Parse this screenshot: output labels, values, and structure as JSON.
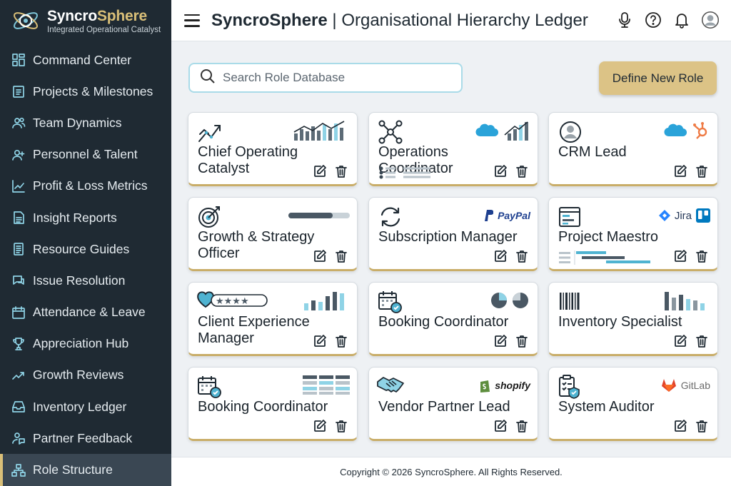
{
  "brand": {
    "name_part1": "Syncro",
    "name_part2": "Sphere",
    "tagline": "Integrated Operational Catalyst"
  },
  "sidebar": {
    "items": [
      {
        "label": "Command Center",
        "icon": "dashboard-icon"
      },
      {
        "label": "Projects & Milestones",
        "icon": "clipboard-icon"
      },
      {
        "label": "Team Dynamics",
        "icon": "team-icon"
      },
      {
        "label": "Personnel & Talent",
        "icon": "user-add-icon"
      },
      {
        "label": "Profit & Loss Metrics",
        "icon": "line-chart-icon"
      },
      {
        "label": "Insight Reports",
        "icon": "report-icon"
      },
      {
        "label": "Resource Guides",
        "icon": "guide-icon"
      },
      {
        "label": "Issue Resolution",
        "icon": "chat-icon"
      },
      {
        "label": "Attendance & Leave",
        "icon": "calendar-icon"
      },
      {
        "label": "Appreciation Hub",
        "icon": "trophy-icon"
      },
      {
        "label": "Growth Reviews",
        "icon": "trend-icon"
      },
      {
        "label": "Inventory Ledger",
        "icon": "inbox-icon"
      },
      {
        "label": "Partner Feedback",
        "icon": "feedback-icon"
      },
      {
        "label": "Role Structure",
        "icon": "hierarchy-icon",
        "active": true
      }
    ]
  },
  "header": {
    "title_strong": "SyncroSphere",
    "title_separator": " | ",
    "title_rest": "Organisational Hierarchy Ledger"
  },
  "search": {
    "placeholder": "Search Role Database"
  },
  "actions": {
    "define_new_role": "Define New Role"
  },
  "roles": [
    {
      "name": "Chief Operating Catalyst",
      "icon": "growth-arrow-icon"
    },
    {
      "name": "Operations Coordinator",
      "icon": "network-icon",
      "logo": "salesforce"
    },
    {
      "name": "CRM Lead",
      "icon": "user-circle-icon",
      "logos": [
        "salesforce",
        "hubspot"
      ]
    },
    {
      "name": "Growth & Strategy Officer",
      "icon": "target-icon"
    },
    {
      "name": "Subscription Manager",
      "icon": "refresh-icon",
      "logo_text": "PayPal"
    },
    {
      "name": "Project Maestro",
      "icon": "kanban-icon",
      "logo_text": "Jira"
    },
    {
      "name": "Client Experience Manager",
      "icon": "heart-rating-icon"
    },
    {
      "name": "Booking Coordinator",
      "icon": "calendar-check-icon"
    },
    {
      "name": "Inventory Specialist",
      "icon": "barcode-icon"
    },
    {
      "name": "Booking Coordinator",
      "icon": "calendar-check-icon"
    },
    {
      "name": "Vendor Partner Lead",
      "icon": "handshake-icon",
      "logo_text": "shopify"
    },
    {
      "name": "System Auditor",
      "icon": "audit-clipboard-icon",
      "logo_text": "GitLab"
    }
  ],
  "colors": {
    "sidebar_bg": "#1f2a33",
    "accent_gold": "#dcc386",
    "icon_cyan": "#8fd3e6"
  },
  "footer": {
    "copyright": "Copyright © 2026 SyncroSphere. All Rights Reserved."
  }
}
